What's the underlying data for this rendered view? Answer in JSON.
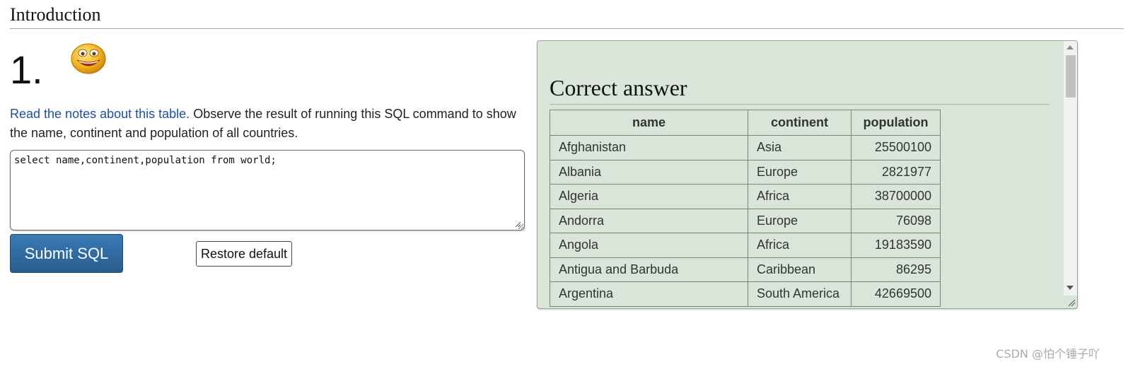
{
  "section": {
    "title": "Introduction"
  },
  "question": {
    "number": "1.",
    "emoji_icon": "smiley-face-icon",
    "link_text": "Read the notes about this table.",
    "instruction": " Observe the result of running this SQL command to show the name, continent and population of all countries."
  },
  "editor": {
    "sql": "select name,continent,population from world;"
  },
  "buttons": {
    "submit_label": "Submit SQL",
    "restore_label": "Restore default"
  },
  "answer": {
    "title": "Correct answer",
    "columns": [
      "name",
      "continent",
      "population"
    ],
    "rows": [
      [
        "Afghanistan",
        "Asia",
        "25500100"
      ],
      [
        "Albania",
        "Europe",
        "2821977"
      ],
      [
        "Algeria",
        "Africa",
        "38700000"
      ],
      [
        "Andorra",
        "Europe",
        "76098"
      ],
      [
        "Angola",
        "Africa",
        "19183590"
      ],
      [
        "Antigua and Barbuda",
        "Caribbean",
        "86295"
      ],
      [
        "Argentina",
        "South America",
        "42669500"
      ]
    ]
  },
  "watermark": "CSDN @怕个锤子吖",
  "colors": {
    "panel_bg": "#dae5da",
    "link": "#1f4fa0",
    "submit_bg": "#2f6ba3"
  }
}
